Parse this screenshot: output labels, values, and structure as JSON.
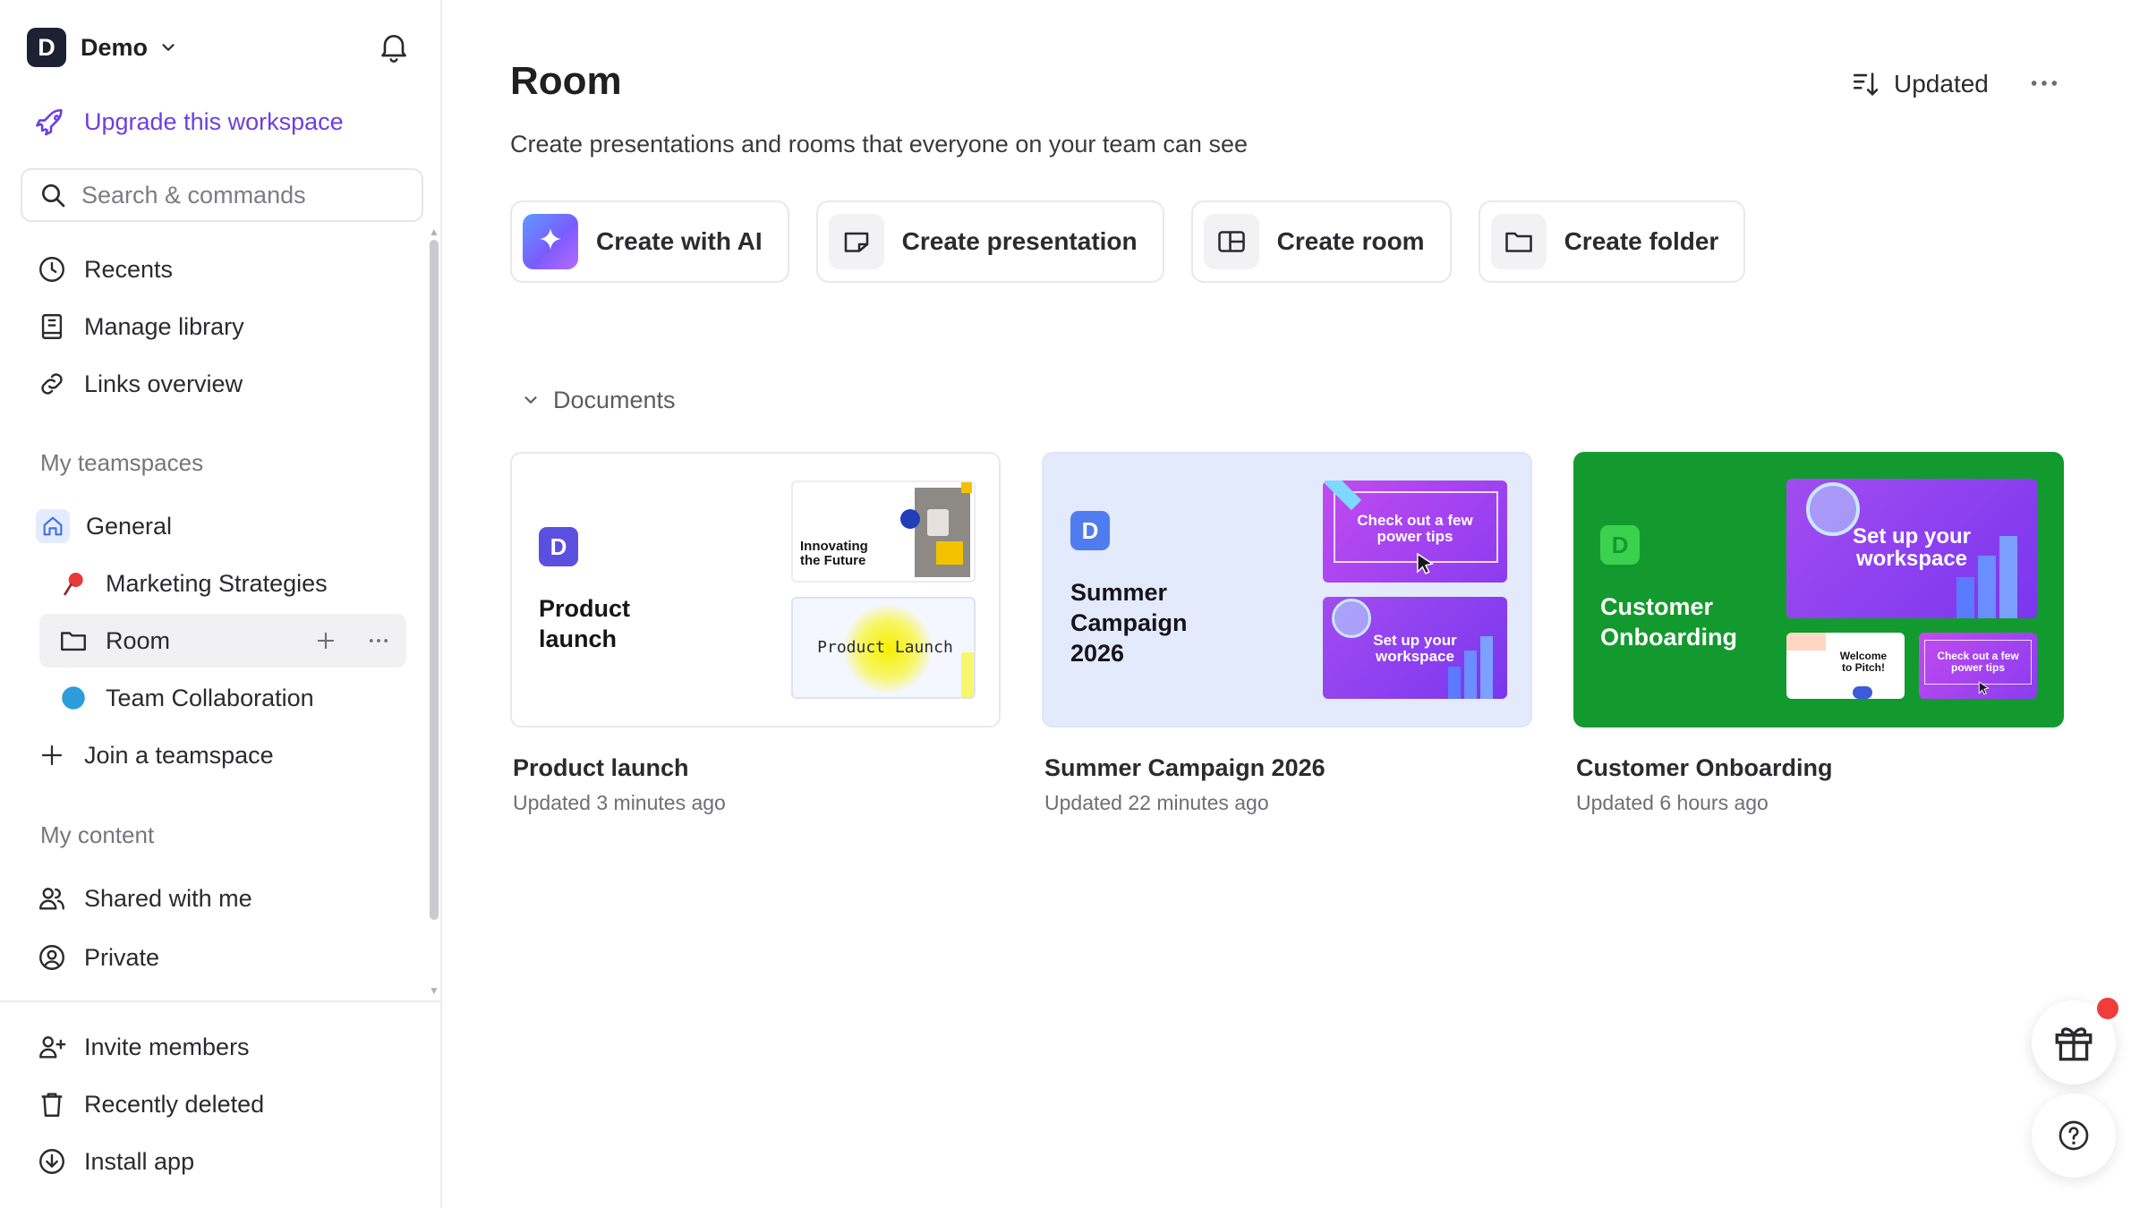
{
  "workspace": {
    "avatar_letter": "D",
    "name": "Demo"
  },
  "sidebar": {
    "upgrade_label": "Upgrade this workspace",
    "search_placeholder": "Search & commands",
    "items": [
      {
        "label": "Recents",
        "icon": "clock-icon"
      },
      {
        "label": "Manage library",
        "icon": "book-icon"
      },
      {
        "label": "Links overview",
        "icon": "link-icon"
      }
    ],
    "teamspaces_title": "My teamspaces",
    "teamspaces": [
      {
        "label": "General",
        "icon": "home-icon"
      },
      {
        "label": "Marketing Strategies",
        "icon": "pin-icon"
      },
      {
        "label": "Room",
        "icon": "folder-icon"
      },
      {
        "label": "Team Collaboration",
        "icon": "wave-icon"
      }
    ],
    "join_label": "Join a teamspace",
    "content_title": "My content",
    "content": [
      {
        "label": "Shared with me",
        "icon": "users-icon"
      },
      {
        "label": "Private",
        "icon": "user-circle-icon"
      }
    ],
    "footer": [
      {
        "label": "Invite members",
        "icon": "user-plus-icon"
      },
      {
        "label": "Recently deleted",
        "icon": "trash-icon"
      },
      {
        "label": "Install app",
        "icon": "download-icon"
      }
    ]
  },
  "main": {
    "title": "Room",
    "subtitle": "Create presentations and rooms that everyone on your team can see",
    "sort_label": "Updated",
    "actions": [
      {
        "label": "Create with AI",
        "icon": "sparkle-icon"
      },
      {
        "label": "Create presentation",
        "icon": "presentation-icon"
      },
      {
        "label": "Create room",
        "icon": "layout-icon"
      },
      {
        "label": "Create folder",
        "icon": "folder-icon"
      }
    ],
    "documents_label": "Documents",
    "documents": [
      {
        "name": "Product launch",
        "updated": "Updated 3 minutes ago",
        "thumb_title": "Product\nlaunch",
        "thumb_badge": "D",
        "slides": [
          "Innovating\nthe Future",
          "Product Launch"
        ],
        "colors": {
          "bg": "#ffffff",
          "badge": "#5b4fe0"
        }
      },
      {
        "name": "Summer Campaign 2026",
        "updated": "Updated 22 minutes ago",
        "thumb_title": "Summer\nCampaign\n2026",
        "thumb_badge": "D",
        "slides": [
          "Check out a few\npower tips",
          "Set up your\nworkspace"
        ],
        "colors": {
          "bg": "#e3eafc",
          "badge": "#4f7df0"
        }
      },
      {
        "name": "Customer Onboarding",
        "updated": "Updated 6 hours ago",
        "thumb_title": "Customer\nOnboarding",
        "thumb_badge": "D",
        "slides": [
          "Set up your\nworkspace",
          "Welcome\nto Pitch!",
          "Check out a few\npower tips"
        ],
        "colors": {
          "bg": "#139a2e",
          "badge": "#3bd14f"
        }
      }
    ]
  },
  "colors": {
    "accent": "#6b3fe0",
    "notification": "#f23b3b"
  }
}
